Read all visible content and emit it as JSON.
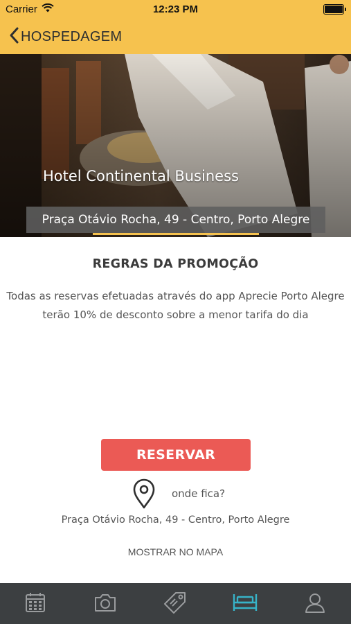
{
  "status_bar": {
    "carrier": "Carrier",
    "time": "12:23 PM",
    "wifi_icon": "wifi-icon",
    "battery_icon": "battery-icon"
  },
  "nav": {
    "back_icon": "chevron-left-icon",
    "title": "HOSPEDAGEM"
  },
  "hotel": {
    "name": "Hotel Continental Business",
    "address": "Praça Otávio Rocha, 49 - Centro, Porto Alegre"
  },
  "rules": {
    "title": "REGRAS DA PROMOÇÃO",
    "line1": "Todas as reservas efetuadas através do app Aprecie Porto Alegre",
    "line2": "terão 10% de desconto sobre a menor tarifa do dia"
  },
  "reserve_label": "RESERVAR",
  "location": {
    "icon": "map-pin-icon",
    "where_label": "onde fica?",
    "address": "Praça Otávio Rocha, 49 - Centro, Porto Alegre",
    "map_link": "MOSTRAR NO MAPA"
  },
  "tabs": [
    {
      "icon": "calendar-icon",
      "active": false
    },
    {
      "icon": "camera-icon",
      "active": false
    },
    {
      "icon": "tag-icon",
      "active": false
    },
    {
      "icon": "bed-icon",
      "active": true
    },
    {
      "icon": "user-icon",
      "active": false
    }
  ],
  "colors": {
    "accent": "#f6c24e",
    "button": "#eb5a55",
    "tab_bar": "#3c3f41",
    "tab_active": "#37b3c8",
    "tab_inactive": "#9a9c9e"
  }
}
